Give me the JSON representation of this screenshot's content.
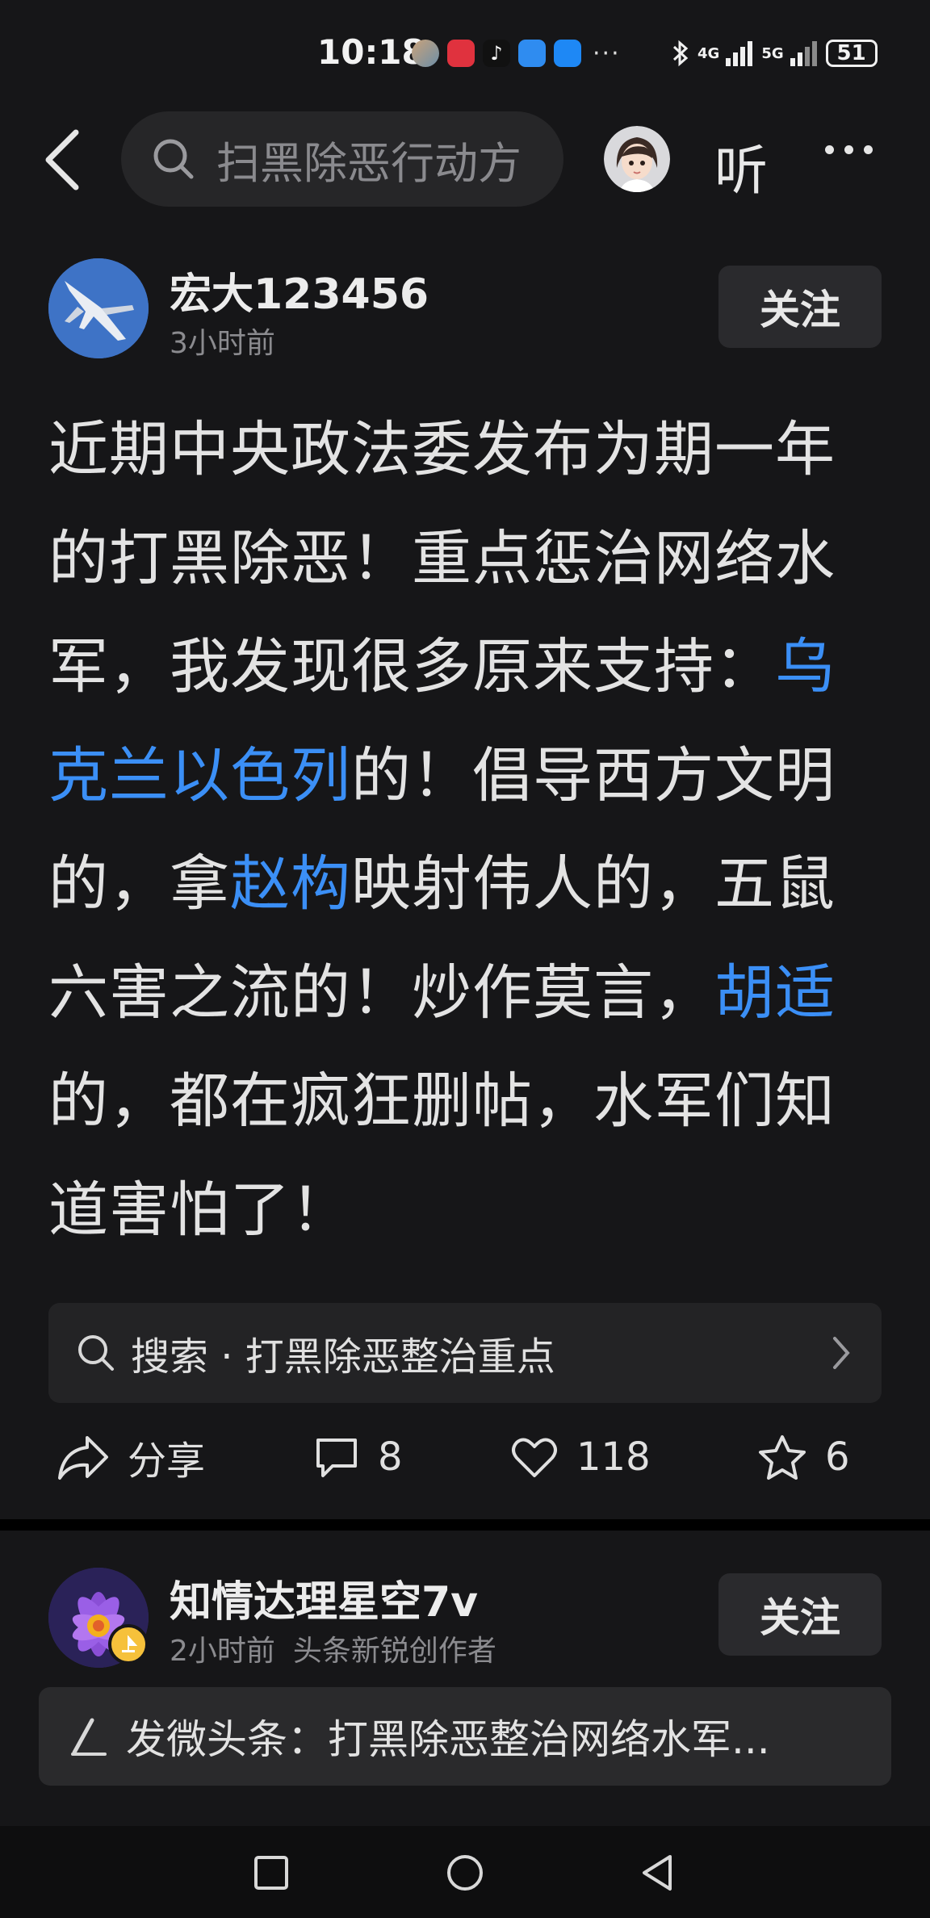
{
  "status_bar": {
    "time": "10:18",
    "network_1": "4G",
    "network_2": "5G",
    "battery": "51"
  },
  "header": {
    "search_placeholder": "扫黑除恶行动方",
    "listen_label": "听"
  },
  "post": {
    "author": "宏大123456",
    "time": "3小时前",
    "follow_label": "关注",
    "content_segments": [
      {
        "text": "近期中央政法委发布为期一年的打黑除恶！重点惩治网络水军，我发现很多原来支持："
      },
      {
        "text": "乌克兰以色列",
        "link": true
      },
      {
        "text": "的！倡导西方文明的，拿"
      },
      {
        "text": "赵构",
        "link": true
      },
      {
        "text": "映射伟人的，五鼠六害之流的！炒作莫言，"
      },
      {
        "text": "胡适",
        "link": true
      },
      {
        "text": "的，都在疯狂删帖，水军们知道害怕了！"
      }
    ],
    "search_chip": "搜索 · 打黑除恶整治重点",
    "actions": {
      "share_label": "分享",
      "comments": "8",
      "likes": "118",
      "favorites": "6"
    }
  },
  "comment_post": {
    "author": "知情达理星空7v",
    "time": "2小时前",
    "author_tag": "头条新锐创作者",
    "follow_label": "关注",
    "compose_text": "发微头条：打黑除恶整治网络水军..."
  },
  "colors": {
    "background": "#161618",
    "link": "#3b8ff6",
    "card": "#2a2a2d"
  }
}
